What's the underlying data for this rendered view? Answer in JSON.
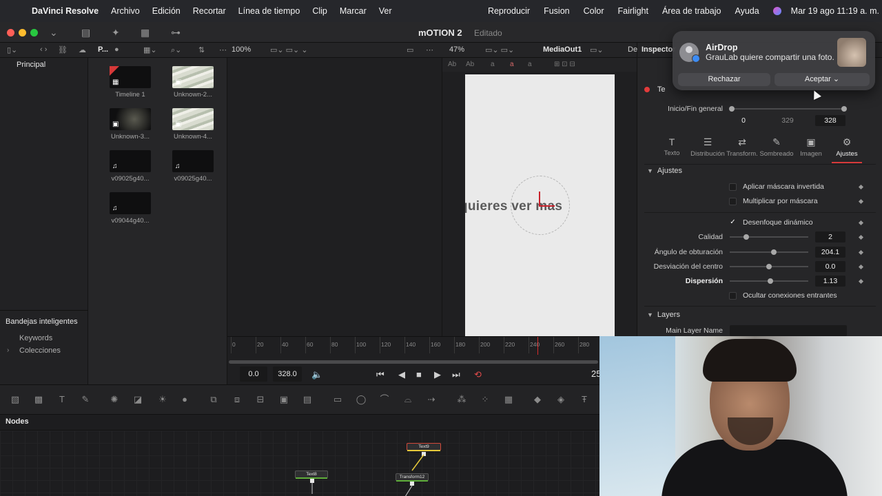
{
  "menubar": {
    "app_name": "DaVinci Resolve",
    "items": [
      "Archivo",
      "Edición",
      "Recortar",
      "Línea de tiempo",
      "Clip",
      "Marcar",
      "Ver"
    ],
    "right_items": [
      "Reproducir",
      "Fusion",
      "Color",
      "Fairlight",
      "Área de trabajo",
      "Ayuda"
    ],
    "clock": "Mar 19 ago 11:19 a. m."
  },
  "titlebar": {
    "project": "mOTION 2",
    "status": "Editado"
  },
  "toolbar": {
    "panel_short": "P...",
    "zoom_left": "100%",
    "zoom_right": "47%",
    "viewer_name": "MediaOut1"
  },
  "media_pool": {
    "root_bin": "Principal",
    "smart_bins": "Bandejas inteligentes",
    "keywords": "Keywords",
    "collections": "Colecciones",
    "clips": [
      {
        "label": "Timeline 1"
      },
      {
        "label": "Unknown-2..."
      },
      {
        "label": "Unknown-3..."
      },
      {
        "label": "Unknown-4..."
      },
      {
        "label": "v09025g40..."
      },
      {
        "label": "v09025g40..."
      },
      {
        "label": "v09044g40..."
      }
    ]
  },
  "viewer": {
    "canvas_text": "quieres ver mas",
    "tool_labels": [
      "Ab",
      "Ab",
      "a",
      "a",
      "a"
    ]
  },
  "timeline": {
    "ticks": [
      "0",
      "20",
      "40",
      "60",
      "80",
      "100",
      "120",
      "140",
      "160",
      "180",
      "200",
      "220",
      "240",
      "260",
      "280"
    ],
    "playhead_frame": 245,
    "start": "0.0",
    "end": "328.0",
    "current_frame": "25"
  },
  "nodes": {
    "label": "Nodes",
    "items": [
      {
        "name": "Text8",
        "color": "#5fae3a"
      },
      {
        "name": "Text9",
        "color": "#e6c93a"
      },
      {
        "name": "Transform12",
        "color": "#5fae3a"
      }
    ]
  },
  "inspector": {
    "panel_prefix": "De",
    "title": "Inspector",
    "tool_name": "Te",
    "range_label": "Inicio/Fin general",
    "range_start": "0",
    "range_mid": "329",
    "range_end": "328",
    "tabs": [
      {
        "label": "Texto",
        "icon": "T"
      },
      {
        "label": "Distribución",
        "icon": "☰"
      },
      {
        "label": "Transform.",
        "icon": "⇄"
      },
      {
        "label": "Sombreado",
        "icon": "✎"
      },
      {
        "label": "Imagen",
        "icon": "▣"
      },
      {
        "label": "Ajustes",
        "icon": "⚙"
      }
    ],
    "active_tab": "Ajustes",
    "section_settings": "Ajustes",
    "apply_mask_inverted": "Aplicar máscara invertida",
    "multiply_by_mask": "Multiplicar por máscara",
    "motion_blur": "Desenfoque dinámico",
    "motion_blur_checked": true,
    "quality_label": "Calidad",
    "quality_value": "2",
    "shutter_label": "Ángulo de obturación",
    "shutter_value": "204.1",
    "center_bias_label": "Desviación del centro",
    "center_bias_value": "0.0",
    "spread_label": "Dispersión",
    "spread_value": "1.13",
    "hide_connections": "Ocultar conexiones entrantes",
    "section_layers": "Layers",
    "main_layer_label": "Main Layer Name"
  },
  "notification": {
    "title": "AirDrop",
    "body": "GrauLab quiere compartir una foto.",
    "reject": "Rechazar",
    "accept": "Aceptar ⌄"
  },
  "colors": {
    "accent_red": "#d83a3a",
    "node_green": "#5fae3a",
    "node_yellow": "#e6c93a"
  }
}
